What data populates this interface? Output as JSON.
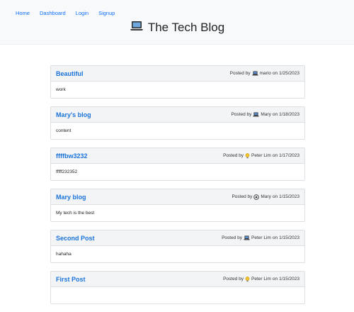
{
  "nav": {
    "home": "Home",
    "dashboard": "Dashboard",
    "login": "Login",
    "signup": "Signup"
  },
  "site": {
    "title": "The Tech Blog",
    "icon": "laptop-icon"
  },
  "posts": [
    {
      "title": "Beautiful",
      "posted_by": "Posted by",
      "author": "mario",
      "on": "on",
      "date": "1/25/2023",
      "content": "work",
      "avatar": "laptop-icon"
    },
    {
      "title": "Mary's blog",
      "posted_by": "Posted by",
      "author": "Mary",
      "on": "on",
      "date": "1/18/2023",
      "content": "content",
      "avatar": "laptop-icon"
    },
    {
      "title": "ffffbw3232",
      "posted_by": "Posted by",
      "author": "Peter Lim",
      "on": "on",
      "date": "1/17/2023",
      "content": "fffff232352",
      "avatar": "lightbulb-icon"
    },
    {
      "title": "Mary blog",
      "posted_by": "Posted by",
      "author": "Mary",
      "on": "on",
      "date": "1/15/2023",
      "content": "My tech is the best",
      "avatar": "gear-icon"
    },
    {
      "title": "Second Post",
      "posted_by": "Posted by",
      "author": "Peter Lim",
      "on": "on",
      "date": "1/15/2023",
      "content": "hahaha",
      "avatar": "laptop-icon"
    },
    {
      "title": "First Post",
      "posted_by": "Posted by",
      "author": "Peter Lim",
      "on": "on",
      "date": "1/15/2023",
      "content": "",
      "avatar": "lightbulb-icon"
    }
  ]
}
